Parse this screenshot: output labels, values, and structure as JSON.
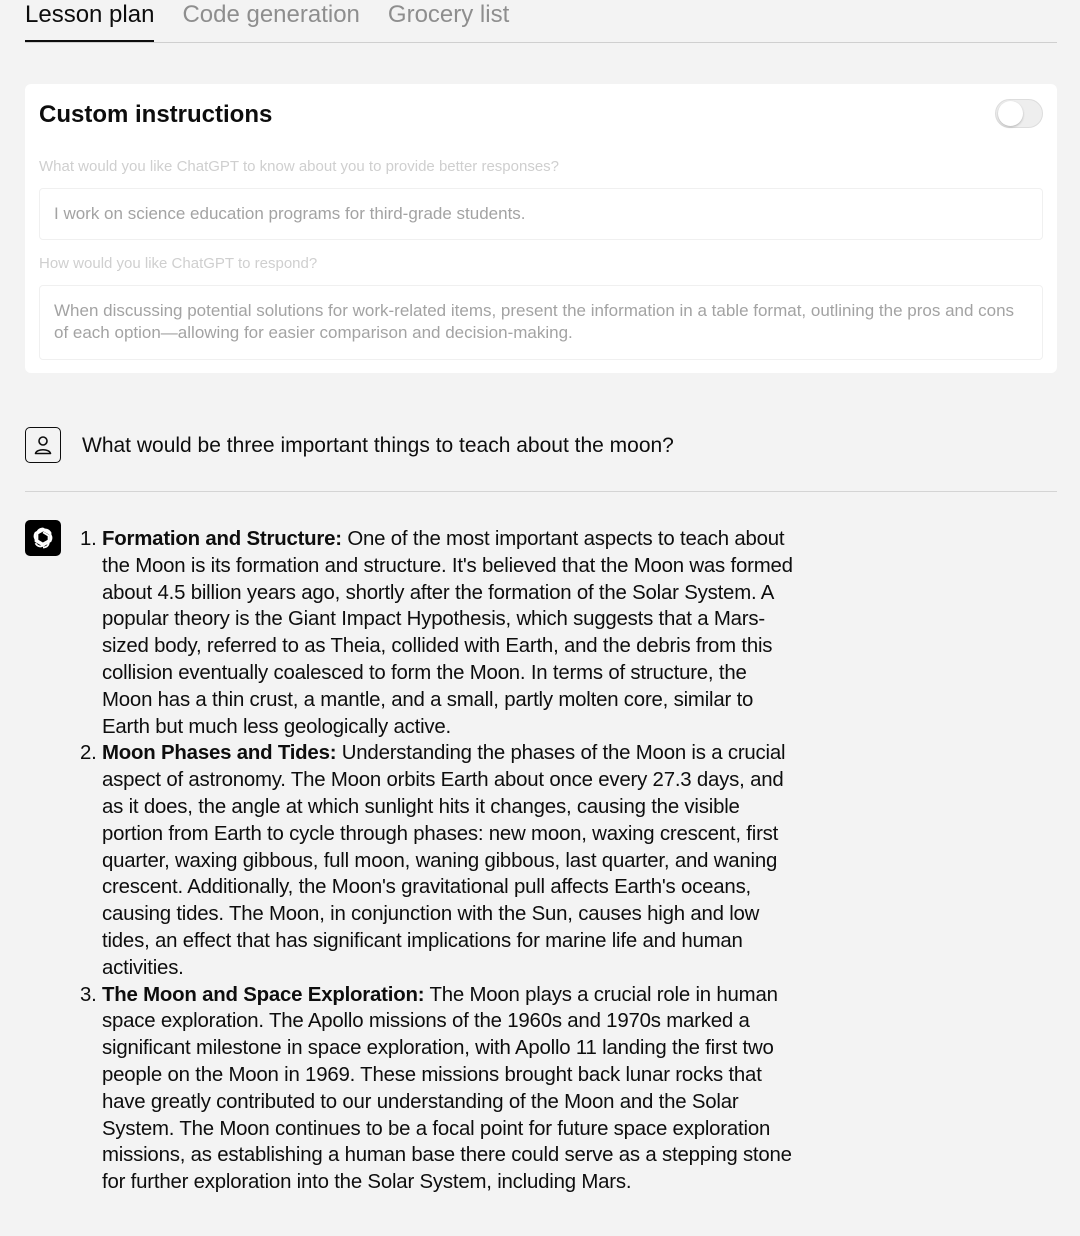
{
  "tabs": [
    {
      "label": "Lesson plan",
      "active": true
    },
    {
      "label": "Code generation",
      "active": false
    },
    {
      "label": "Grocery list",
      "active": false
    }
  ],
  "custom_instructions": {
    "title": "Custom instructions",
    "toggle_on": false,
    "about_label": "What would you like ChatGPT to know about you to provide better responses?",
    "about_value": "I work on science education programs for third-grade students.",
    "respond_label": "How would you like ChatGPT to respond?",
    "respond_value": "When discussing potential solutions for work-related items, present the information in a table format, outlining the pros and cons of each option—allowing for easier comparison and decision-making."
  },
  "user_message": "What would be three important things to teach about the moon?",
  "assistant": {
    "items": [
      {
        "number": "1.",
        "title": "Formation and Structure:",
        "text": " One of the most important aspects to teach about the Moon is its formation and structure. It's believed that the Moon was formed about 4.5 billion years ago, shortly after the formation of the Solar System. A popular theory is the Giant Impact Hypothesis, which suggests that a Mars-sized body, referred to as Theia, collided with Earth, and the debris from this collision eventually coalesced to form the Moon. In terms of structure, the Moon has a thin crust, a mantle, and a small, partly molten core, similar to Earth but much less geologically active."
      },
      {
        "number": "2.",
        "title": "Moon Phases and Tides:",
        "text": " Understanding the phases of the Moon is a crucial aspect of astronomy. The Moon orbits Earth about once every 27.3 days, and as it does, the angle at which sunlight hits it changes, causing the visible portion from Earth to cycle through phases: new moon, waxing crescent, first quarter, waxing gibbous, full moon, waning gibbous, last quarter, and waning crescent. Additionally, the Moon's gravitational pull affects Earth's oceans, causing tides. The Moon, in conjunction with the Sun, causes high and low tides, an effect that has significant implications for marine life and human activities."
      },
      {
        "number": "3.",
        "title": "The Moon and Space Exploration:",
        "text": " The Moon plays a crucial role in human space exploration. The Apollo missions of the 1960s and 1970s marked a significant milestone in space exploration, with Apollo 11 landing the first two people on the Moon in 1969. These missions brought back lunar rocks that have greatly contributed to our understanding of the Moon and the Solar System. The Moon continues to be a focal point for future space exploration missions, as establishing a human base there could serve as a stepping stone for further exploration into the Solar System, including Mars."
      }
    ]
  }
}
